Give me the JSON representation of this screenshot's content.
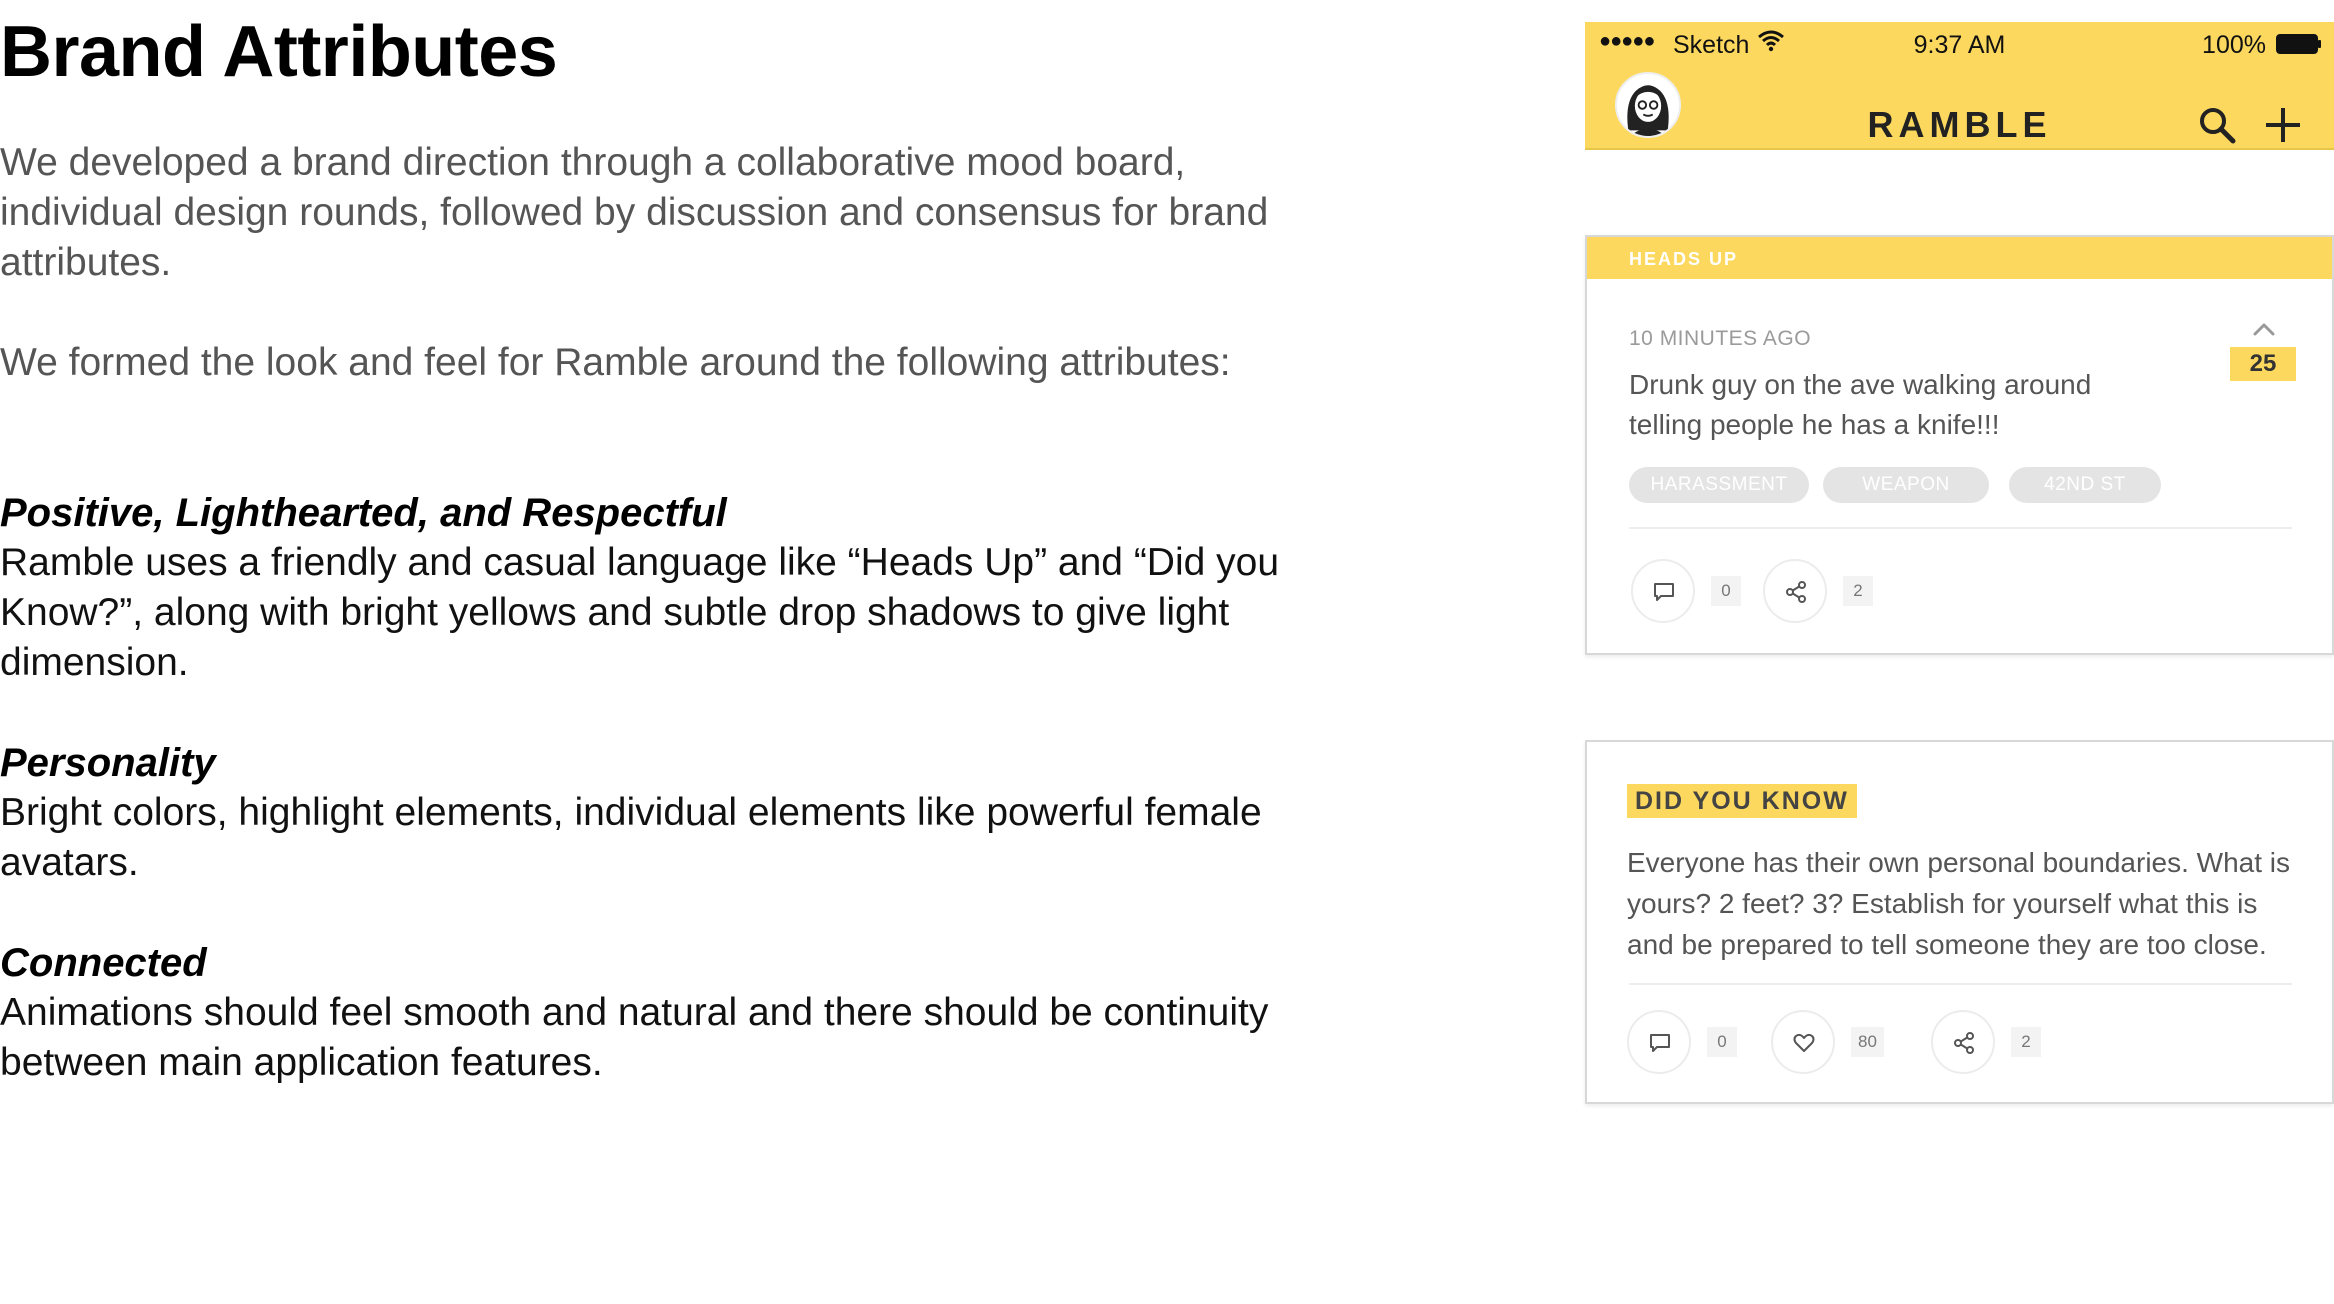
{
  "slide": {
    "title": "Brand Attributes",
    "intro_1": "We developed a brand direction through a collaborative mood board, individual design rounds, followed by discussion and consensus for brand attributes.",
    "intro_2": "We formed the look and feel for Ramble around the following attributes:",
    "attributes": [
      {
        "heading": "Positive, Lighthearted, and Respectful",
        "body": "Ramble uses a friendly and casual language like “Heads Up” and “Did you Know?”, along with bright yellows and subtle drop shadows to give light dimension."
      },
      {
        "heading": "Personality",
        "body": "Bright colors, highlight elements, individual elements like powerful female avatars."
      },
      {
        "heading": "Connected",
        "body": "Animations should feel smooth and natural and there should be continuity between main application features."
      }
    ]
  },
  "phone": {
    "status": {
      "signal": "●●●●●",
      "carrier": "Sketch",
      "time": "9:37 AM",
      "battery": "100%"
    },
    "app_title": "RAMBLE",
    "icons": {
      "avatar": "avatar-icon",
      "search": "search-icon",
      "add": "plus-icon"
    }
  },
  "heads_up_card": {
    "banner": "HEADS UP",
    "timestamp": "10 MINUTES AGO",
    "text": "Drunk guy on the ave walking around telling people he has a knife!!!",
    "votes": "25",
    "tags": [
      "HARASSMENT",
      "WEAPON",
      "42ND ST"
    ],
    "comments": "0",
    "shares": "2"
  },
  "did_you_know_card": {
    "label": "DID YOU KNOW",
    "text": "Everyone has their own personal boundaries. What is yours?  2 feet? 3? Establish for yourself what this is and be prepared to tell someone they are too close.",
    "comments": "0",
    "likes": "80",
    "shares": "2"
  },
  "colors": {
    "brand_yellow": "#fcd95e",
    "text_gray": "#555555",
    "tag_gray": "#e4e4e4"
  }
}
